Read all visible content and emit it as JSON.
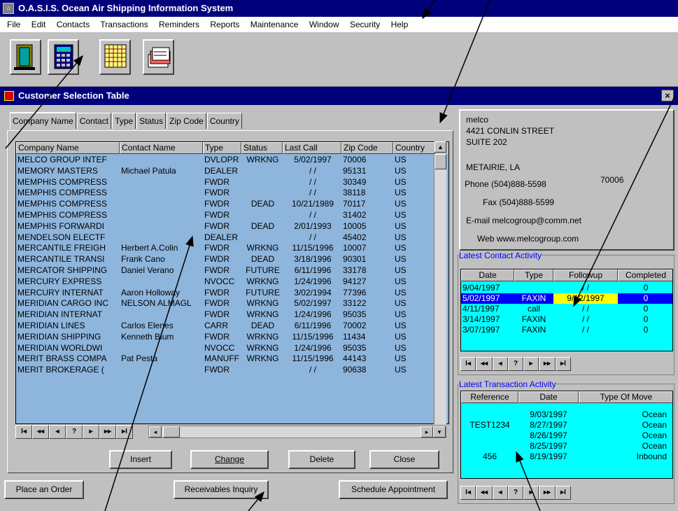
{
  "app": {
    "title": "O.A.S.I.S.   Ocean Air Shipping Information System"
  },
  "menu": [
    "File",
    "Edit",
    "Contacts",
    "Transactions",
    "Reminders",
    "Reports",
    "Maintenance",
    "Window",
    "Security",
    "Help"
  ],
  "toolbar": {
    "buttons": [
      {
        "icon": "exit-door-icon"
      },
      {
        "icon": "calculator-icon"
      },
      {
        "icon": "grid-table-icon"
      },
      {
        "icon": "card-file-icon"
      }
    ]
  },
  "window": {
    "title": "Customer Selection Table",
    "close": "×"
  },
  "tabs": [
    "Company Name",
    "Contact",
    "Type",
    "Status",
    "Zip Code",
    "Country"
  ],
  "grid": {
    "columns": [
      "Company Name",
      "Contact Name",
      "Type",
      "Status",
      "Last Call",
      "Zip Code",
      "Country"
    ],
    "rows": [
      [
        "MELCO GROUP INTEF",
        "",
        "DVLOPR",
        "WRKNG",
        "5/02/1997",
        "70006",
        "US"
      ],
      [
        "MEMORY MASTERS",
        "Michael Patula",
        "DEALER",
        "",
        "/ /",
        "95131",
        "US"
      ],
      [
        "MEMPHIS COMPRESS",
        "",
        "FWDR",
        "",
        "/ /",
        "30349",
        "US"
      ],
      [
        "MEMPHIS COMPRESS",
        "",
        "FWDR",
        "",
        "/ /",
        "38118",
        "US"
      ],
      [
        "MEMPHIS COMPRESS",
        "",
        "FWDR",
        "DEAD",
        "10/21/1989",
        "70117",
        "US"
      ],
      [
        "MEMPHIS COMPRESS",
        "",
        "FWDR",
        "",
        "/ /",
        "31402",
        "US"
      ],
      [
        "MEMPHIS FORWARDI",
        "",
        "FWDR",
        "DEAD",
        "2/01/1993",
        "10005",
        "US"
      ],
      [
        "MENDELSON ELECTF",
        "",
        "DEALER",
        "",
        "/ /",
        "45402",
        "US"
      ],
      [
        "MERCANTILE FREIGH",
        "Herbert A.Colin",
        "FWDR",
        "WRKNG",
        "11/15/1996",
        "10007",
        "US"
      ],
      [
        "MERCANTILE TRANSI",
        "Frank Cano",
        "FWDR",
        "DEAD",
        "3/18/1996",
        "90301",
        "US"
      ],
      [
        "MERCATOR SHIPPING",
        "Daniel Verano",
        "FWDR",
        "FUTURE",
        "6/11/1996",
        "33178",
        "US"
      ],
      [
        "MERCURY EXPRESS",
        "",
        "NVOCC",
        "WRKNG",
        "1/24/1996",
        "94127",
        "US"
      ],
      [
        "MERCURY INTERNAT",
        "Aaron Holloway",
        "FWDR",
        "FUTURE",
        "3/02/1994",
        "77396",
        "US"
      ],
      [
        "MERIDIAN CARGO INC",
        "NELSON ALMAGL",
        "FWDR",
        "WRKNG",
        "5/02/1997",
        "33122",
        "US"
      ],
      [
        "MERIDIAN INTERNAT",
        "",
        "FWDR",
        "WRKNG",
        "1/24/1996",
        "95035",
        "US"
      ],
      [
        "MERIDIAN LINES",
        "Carlos Elenes",
        "CARR",
        "DEAD",
        "6/11/1996",
        "70002",
        "US"
      ],
      [
        "MERIDIAN SHIPPING",
        "Kenneth Blum",
        "FWDR",
        "WRKNG",
        "11/15/1996",
        "11434",
        "US"
      ],
      [
        "MERIDIAN WORLDWI",
        "",
        "NVOCC",
        "WRKNG",
        "1/24/1996",
        "95035",
        "US"
      ],
      [
        "MERIT BRASS COMPA",
        "Pat Pesta",
        "MANUFF",
        "WRKNG",
        "11/15/1996",
        "44143",
        "US"
      ],
      [
        "MERIT BROKERAGE (",
        "",
        "FWDR",
        "",
        "/ /",
        "90638",
        "US"
      ]
    ]
  },
  "nav": [
    "I◂",
    "◂◂",
    "◂",
    "?",
    "▸",
    "▸▸",
    "▸I"
  ],
  "buttons": {
    "insert": "Insert",
    "change": "Change",
    "delete": "Delete",
    "close": "Close",
    "place_order": "Place an Order",
    "receivables": "Receivables Inquiry",
    "schedule": "Schedule Appointment"
  },
  "address": {
    "name": "melco",
    "street": "4421 CONLIN STREET",
    "suite": "SUITE 202",
    "city": "METAIRIE, LA",
    "zip": "70006",
    "phone": "Phone (504)888-5598",
    "fax": "Fax (504)888-5599",
    "email": "E-mail melcogroup@comm.net",
    "web": "Web www.melcogroup.com"
  },
  "contact_activity": {
    "label": "Latest Contact Activity",
    "columns": [
      "Date",
      "Type",
      "Followup",
      "Completed"
    ],
    "rows": [
      [
        "9/04/1997",
        "",
        "/ /",
        "0"
      ],
      [
        "5/02/1997",
        "FAXIN",
        "9/12/1997",
        "0"
      ],
      [
        "4/11/1997",
        "call",
        "/ /",
        "0"
      ],
      [
        "3/14/1997",
        "FAXIN",
        "/ /",
        "0"
      ],
      [
        "3/07/1997",
        "FAXIN",
        "/ /",
        "0"
      ]
    ]
  },
  "transaction_activity": {
    "label": "Latest Transaction Activity",
    "columns": [
      "Reference",
      "Date",
      "Type Of Move"
    ],
    "rows": [
      [
        "",
        "9/03/1997",
        "Ocean"
      ],
      [
        "TEST1234",
        "8/27/1997",
        "Ocean"
      ],
      [
        "",
        "8/26/1997",
        "Ocean"
      ],
      [
        "",
        "8/25/1997",
        "Ocean"
      ],
      [
        "456",
        "8/19/1997",
        "Inbound"
      ]
    ]
  },
  "colors": {
    "titlebar": "#00007b",
    "grid_bg": "#8eb5dc",
    "activity_bg": "#00ffff",
    "selected_row": "#0000ff",
    "followup_highlight": "#ffff00"
  }
}
